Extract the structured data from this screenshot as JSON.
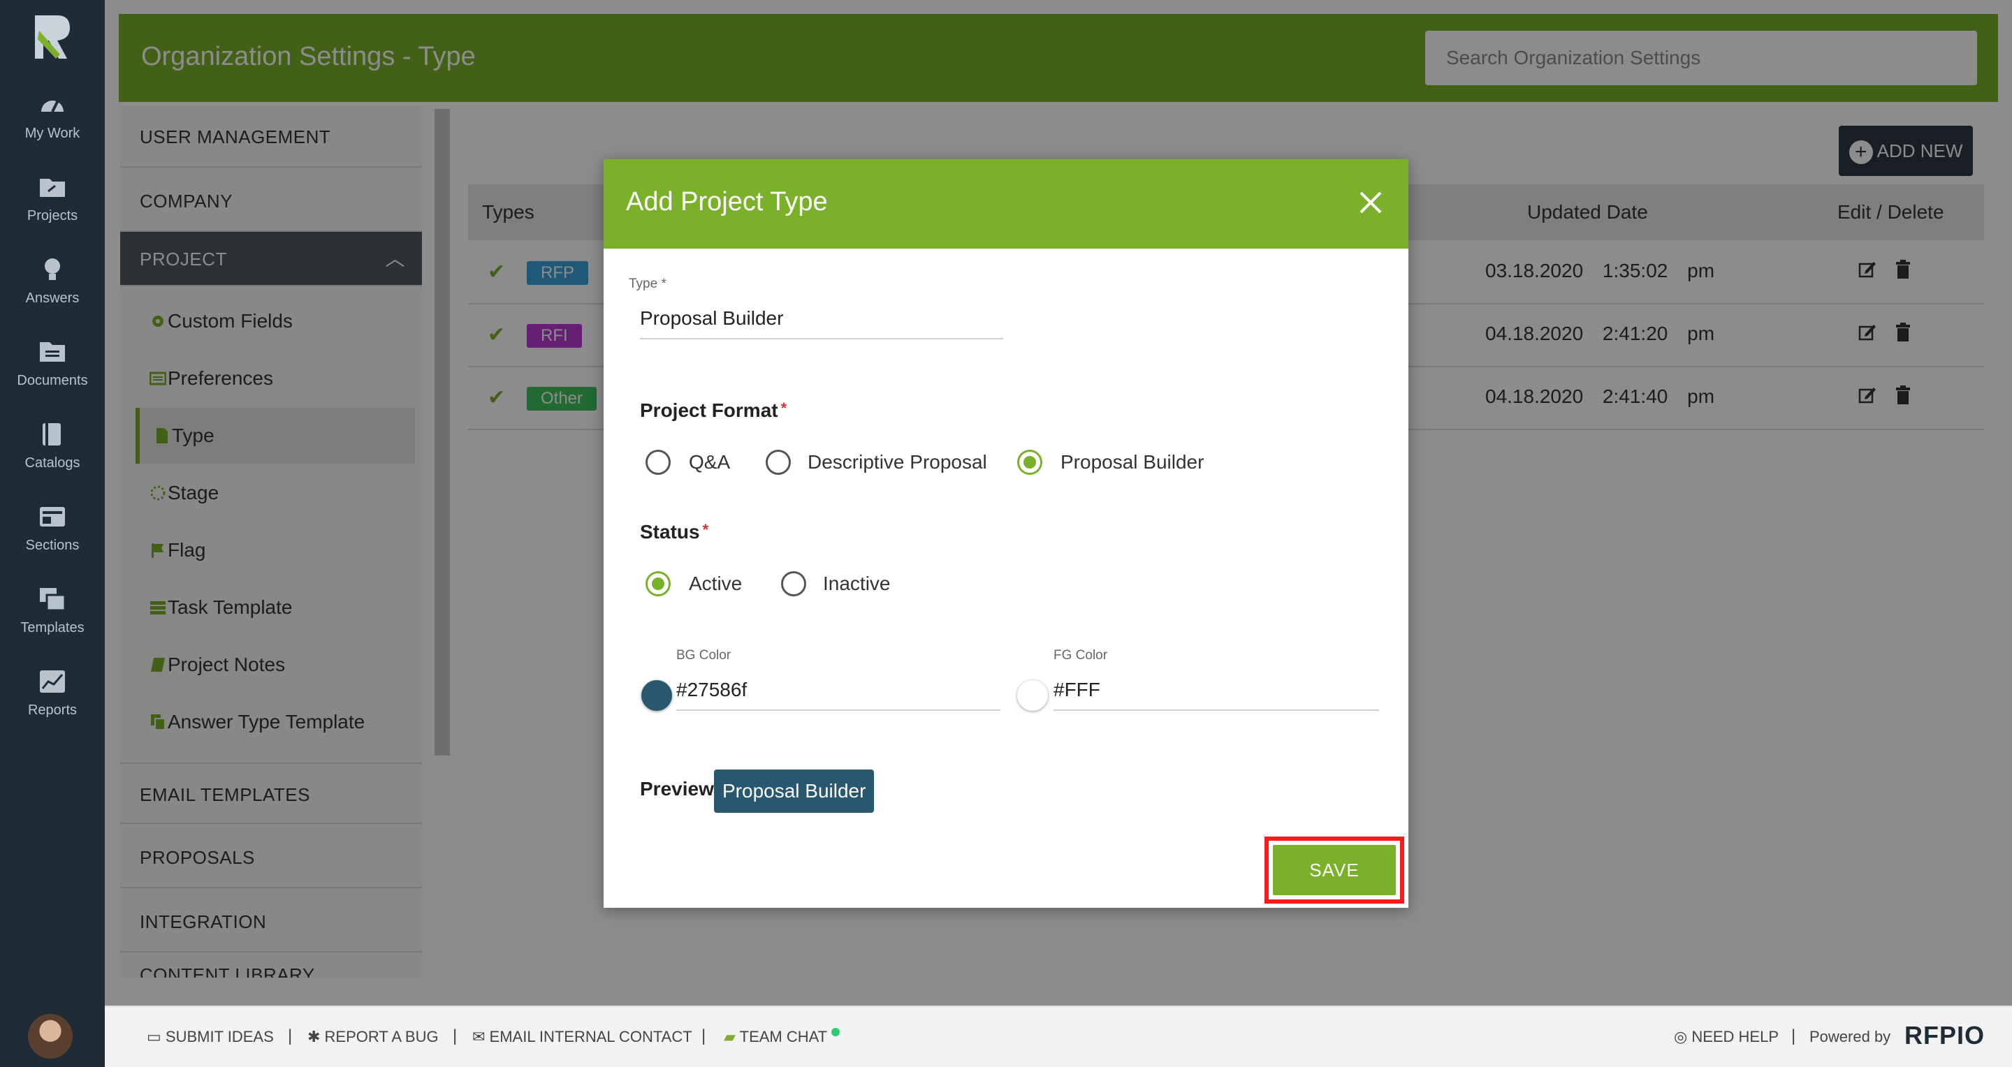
{
  "nav": {
    "items": [
      {
        "label": "My Work",
        "icon": "dashboard-icon"
      },
      {
        "label": "Projects",
        "icon": "folder-icon"
      },
      {
        "label": "Answers",
        "icon": "lightbulb-icon"
      },
      {
        "label": "Documents",
        "icon": "documents-icon"
      },
      {
        "label": "Catalogs",
        "icon": "book-icon"
      },
      {
        "label": "Sections",
        "icon": "sections-icon"
      },
      {
        "label": "Templates",
        "icon": "templates-icon"
      },
      {
        "label": "Reports",
        "icon": "chart-icon"
      }
    ]
  },
  "header": {
    "title": "Organization Settings - Type",
    "search_placeholder": "Search Organization Settings"
  },
  "sidebar": {
    "sections": [
      "USER MANAGEMENT",
      "COMPANY",
      "PROJECT",
      "EMAIL TEMPLATES",
      "PROPOSALS",
      "INTEGRATION",
      "CONTENT LIBRARY"
    ],
    "project_items": [
      "Custom Fields",
      "Preferences",
      "Type",
      "Stage",
      "Flag",
      "Task Template",
      "Project Notes",
      "Answer Type Template"
    ]
  },
  "table": {
    "add_new": "ADD NEW",
    "columns": {
      "types": "Types",
      "updated": "Updated Date",
      "edit": "Edit / Delete"
    },
    "rows": [
      {
        "tag": "RFP",
        "tag_color": "#3aa3d9",
        "date": "03.18.2020",
        "time": "1:35:02 pm"
      },
      {
        "tag": "RFI",
        "tag_color": "#b93ad6",
        "date": "04.18.2020",
        "time": "2:41:20 pm"
      },
      {
        "tag": "Other",
        "tag_color": "#3fbf5f",
        "date": "04.18.2020",
        "time": "2:41:40 pm"
      }
    ]
  },
  "modal": {
    "title": "Add Project Type",
    "type_label": "Type *",
    "type_value": "Proposal Builder",
    "format_label": "Project Format",
    "format_options": [
      "Q&A",
      "Descriptive Proposal",
      "Proposal Builder"
    ],
    "format_selected": "Proposal Builder",
    "status_label": "Status",
    "status_options": [
      "Active",
      "Inactive"
    ],
    "status_selected": "Active",
    "bg_label": "BG Color",
    "bg_value": "#27586f",
    "fg_label": "FG Color",
    "fg_value": "#FFF",
    "preview_label": "Preview:",
    "preview_text": "Proposal Builder",
    "save": "SAVE"
  },
  "footer": {
    "submit": "SUBMIT IDEAS",
    "bug": "REPORT A BUG",
    "email": "EMAIL INTERNAL CONTACT",
    "chat": "TEAM CHAT",
    "help": "NEED HELP",
    "powered": "Powered by",
    "brand": "RFPIO"
  },
  "colors": {
    "accent": "#7bb02a",
    "rail": "#1f2b36",
    "highlight": "#ff1a1a"
  }
}
